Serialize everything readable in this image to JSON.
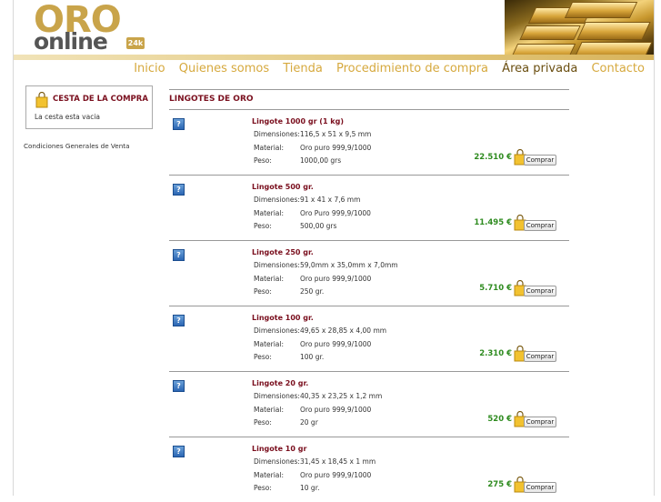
{
  "logo": {
    "oro": "ORO",
    "online": "online",
    "badge": "24k"
  },
  "nav": [
    {
      "label": "Inicio"
    },
    {
      "label": "Quienes somos"
    },
    {
      "label": "Tienda"
    },
    {
      "label": "Procedimiento de compra"
    },
    {
      "label": "Área privada"
    },
    {
      "label": "Contacto"
    }
  ],
  "cart": {
    "title": "CESTA DE LA COMPRA",
    "empty_text": "La cesta esta vacia"
  },
  "conditions_link": "Condiciones Generales de Venta",
  "section_title": "LINGOTES DE ORO",
  "field_labels": {
    "dimensions": "Dimensiones:",
    "material": "Material:",
    "weight": "Peso:"
  },
  "buy_label": "Comprar",
  "help_icon_glyph": "?",
  "products": [
    {
      "name": "Lingote 1000 gr (1 kg)",
      "dimensions": "116,5 x 51 x 9,5 mm",
      "material": "Oro puro 999,9/1000",
      "weight": "1000,00 grs",
      "price": "22.510 €"
    },
    {
      "name": "Lingote 500 gr.",
      "dimensions": "91 x 41 x 7,6 mm",
      "material": "Oro Puro 999,9/1000",
      "weight": "500,00 grs",
      "price": "11.495 €"
    },
    {
      "name": "Lingote 250 gr.",
      "dimensions": "59,0mm x 35,0mm x 7,0mm",
      "material": "Oro puro 999,9/1000",
      "weight": "250 gr.",
      "price": "5.710 €"
    },
    {
      "name": "Lingote 100 gr.",
      "dimensions": "49,65 x 28,85 x 4,00 mm",
      "material": "Oro puro 999,9/1000",
      "weight": "100 gr.",
      "price": "2.310 €"
    },
    {
      "name": "Lingote 20 gr.",
      "dimensions": "40,35 x 23,25 x 1,2 mm",
      "material": "Oro puro 999,9/1000",
      "weight": "20 gr",
      "price": "520 €"
    },
    {
      "name": "Lingote 10 gr",
      "dimensions": "31,45 x 18,45 x 1 mm",
      "material": "Oro puro 999,9/1000",
      "weight": "10 gr.",
      "price": "275 €"
    }
  ],
  "colors": {
    "gold": "#d6a93e",
    "title_red": "#7a0f1e",
    "price_green": "#2e8b1f"
  }
}
